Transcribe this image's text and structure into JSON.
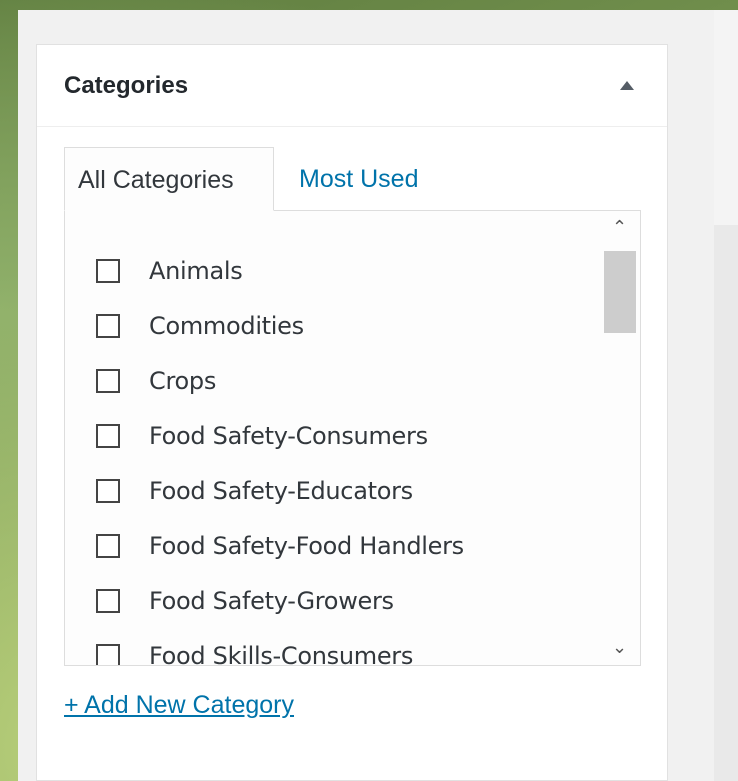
{
  "metabox": {
    "title": "Categories",
    "toggle_icon": "triangle-up-icon"
  },
  "tabs": [
    {
      "label": "All Categories",
      "active": true
    },
    {
      "label": "Most Used",
      "active": false
    }
  ],
  "categories": [
    {
      "label": "Animals",
      "checked": false
    },
    {
      "label": "Commodities",
      "checked": false
    },
    {
      "label": "Crops",
      "checked": false
    },
    {
      "label": "Food Safety-Consumers",
      "checked": false
    },
    {
      "label": "Food Safety-Educators",
      "checked": false
    },
    {
      "label": "Food Safety-Food Handlers",
      "checked": false
    },
    {
      "label": "Food Safety-Growers",
      "checked": false
    },
    {
      "label": "Food Skills-Consumers",
      "checked": false
    }
  ],
  "add_new_label": "+ Add New Category",
  "colors": {
    "link": "#0073aa",
    "text": "#32373c",
    "title": "#23282d",
    "panel_bg": "#f1f1f1"
  }
}
